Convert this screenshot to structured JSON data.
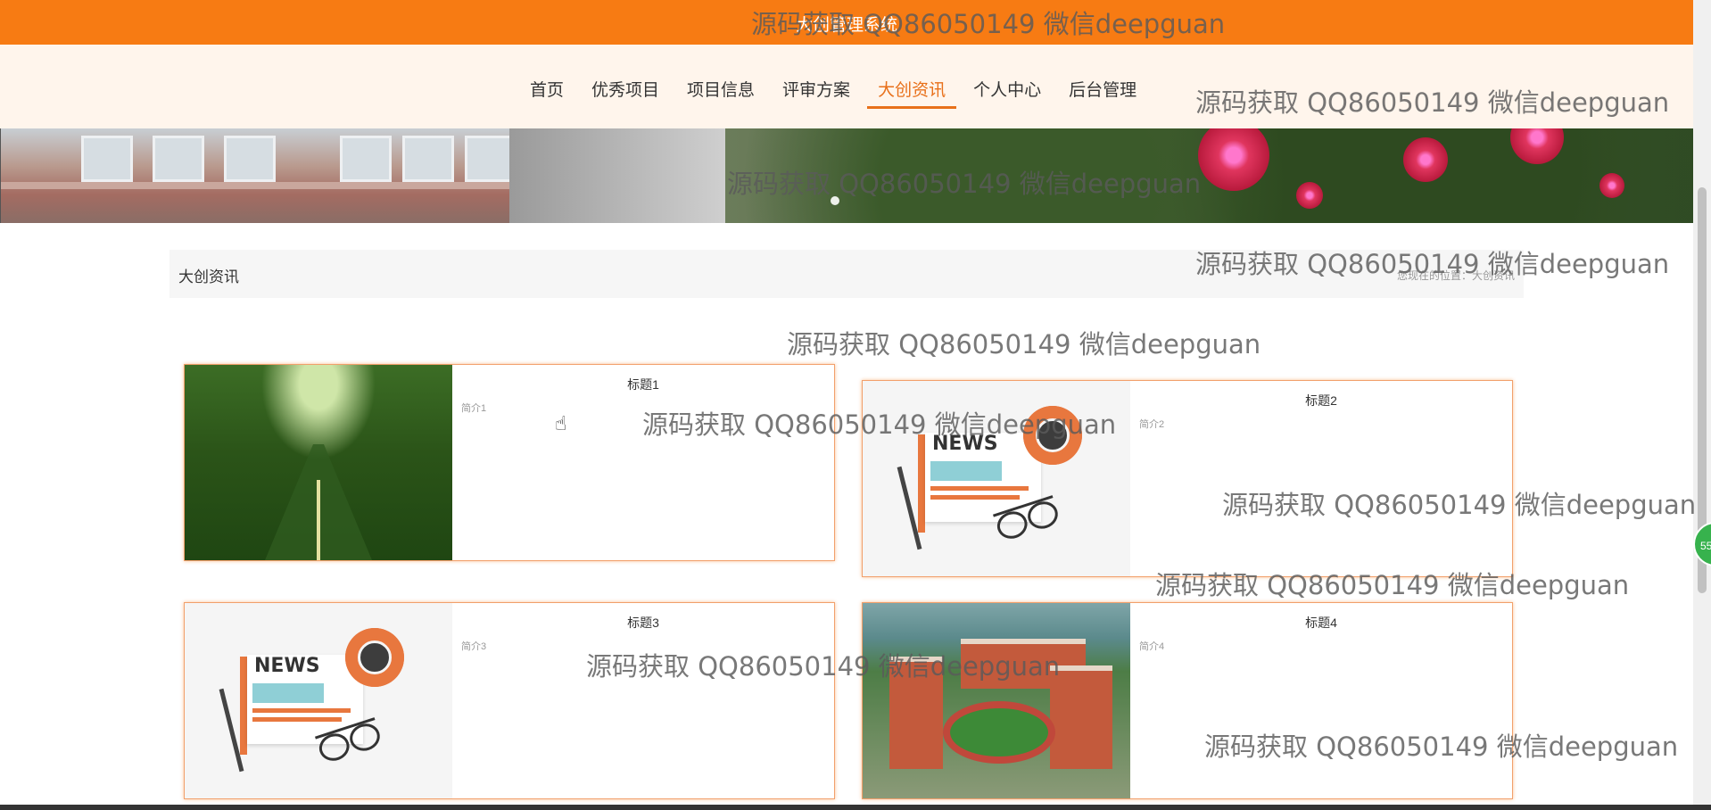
{
  "header": {
    "site_title": "大创管理系统"
  },
  "nav": {
    "items": [
      {
        "label": "首页",
        "active": false
      },
      {
        "label": "优秀项目",
        "active": false
      },
      {
        "label": "项目信息",
        "active": false
      },
      {
        "label": "评审方案",
        "active": false
      },
      {
        "label": "大创资讯",
        "active": true
      },
      {
        "label": "个人中心",
        "active": false
      },
      {
        "label": "后台管理",
        "active": false
      }
    ],
    "active_color": "#e8701a"
  },
  "section": {
    "title": "大创资讯",
    "breadcrumb": "您现在的位置：大创资讯"
  },
  "news": [
    {
      "title": "标题1",
      "summary": "简介1",
      "image": "tree-road-image"
    },
    {
      "title": "标题2",
      "summary": "简介2",
      "image": "news-illustration-image"
    },
    {
      "title": "标题3",
      "summary": "简介3",
      "image": "news-illustration-image"
    },
    {
      "title": "标题4",
      "summary": "简介4",
      "image": "campus-aerial-image"
    }
  ],
  "side_badge": "55",
  "watermark_text": "源码获取 QQ86050149 微信deepguan",
  "colors": {
    "header_orange": "#f77b13",
    "nav_background": "#fff5ec",
    "card_border": "#f2a06b"
  }
}
